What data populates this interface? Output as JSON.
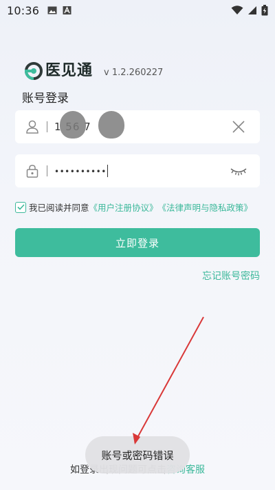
{
  "status_bar": {
    "time": "10:36"
  },
  "brand": {
    "name": "医见通",
    "version": "v 1.2.260227"
  },
  "login": {
    "title": "账号登录",
    "account_value": "1      56    7",
    "password_value": "••••••••••",
    "agree_prefix": "我已阅读并同意",
    "user_agreement": "《用户注册协议》",
    "privacy_policy": "《法律声明与隐私政策》",
    "agreed": true,
    "login_button": "立即登录",
    "forgot_link": "忘记账号密码"
  },
  "help": {
    "prefix": "如登录出现问题可点击",
    "link": "咨询客服"
  },
  "toast": {
    "message": "账号或密码错误"
  },
  "colors": {
    "accent": "#3ebc9d",
    "annotation": "#d93838"
  }
}
